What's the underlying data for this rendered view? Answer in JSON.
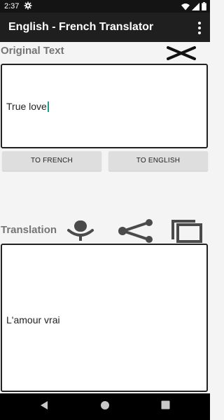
{
  "status_bar": {
    "time": "2:37"
  },
  "app_bar": {
    "title": "English - French Translator"
  },
  "original": {
    "label": "Original Text",
    "input_text": "True love"
  },
  "buttons": {
    "to_french": "TO FRENCH",
    "to_english": "TO ENGLISH"
  },
  "translation": {
    "label": "Translation",
    "output_text": "L'amour vrai"
  },
  "icons": {
    "clear": "close-icon",
    "mic": "microphone-icon",
    "share": "share-icon",
    "copy": "copy-icon"
  },
  "colors": {
    "caret": "#1a9e8f",
    "app_bar": "#1f1f1f",
    "label": "#757575"
  }
}
